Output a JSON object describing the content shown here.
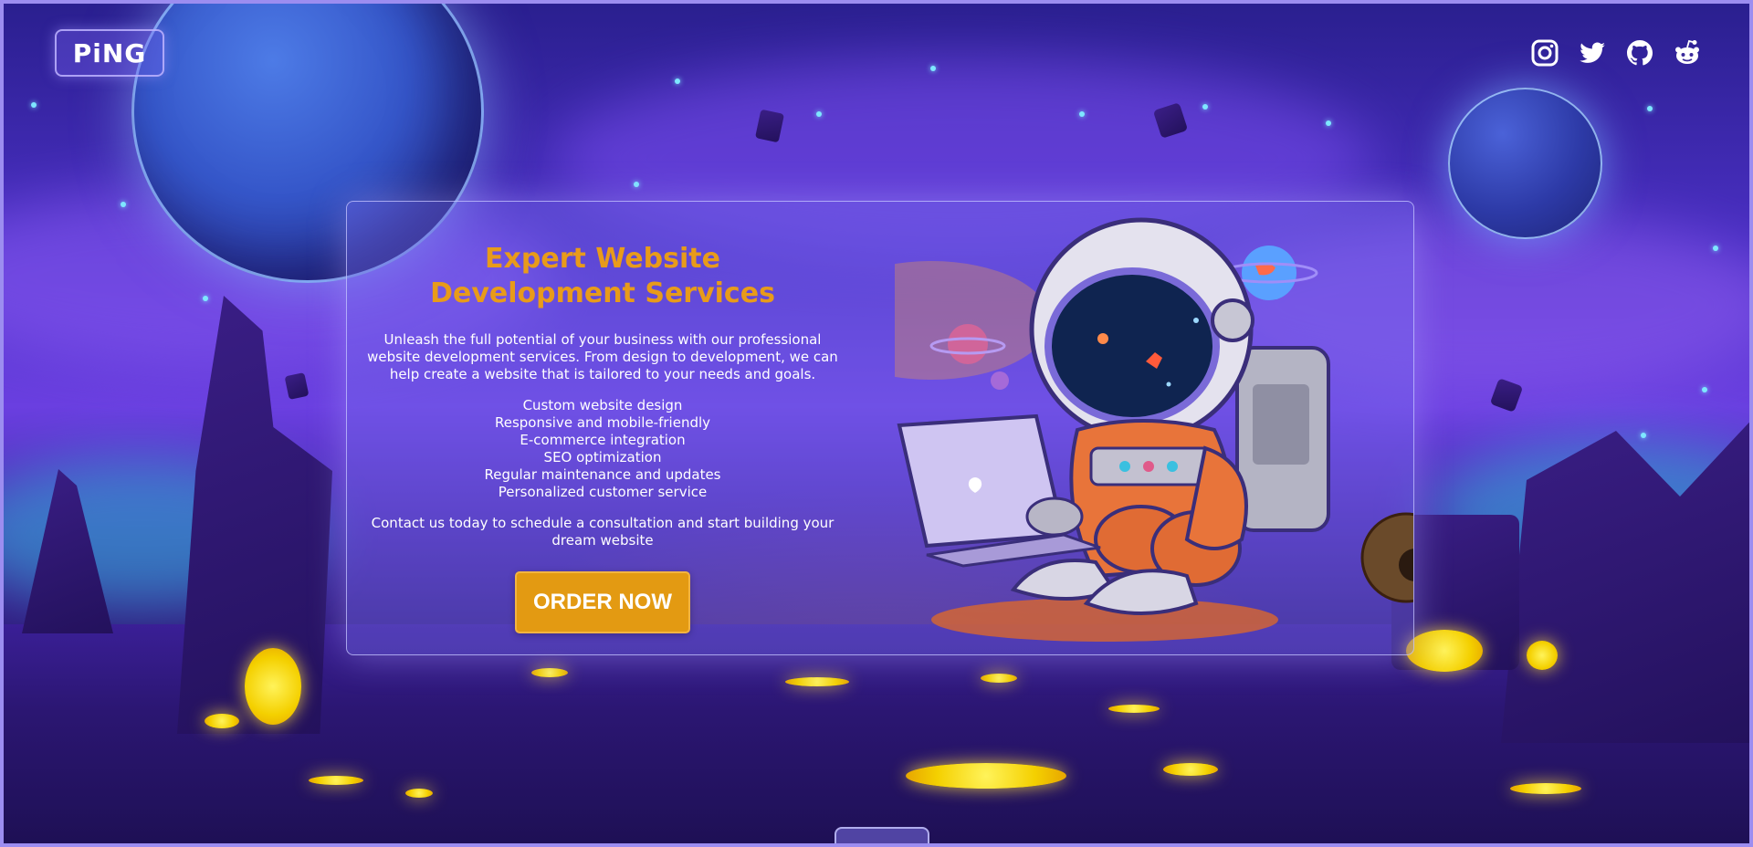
{
  "logo": {
    "text": "PiNG"
  },
  "socials": [
    {
      "name": "instagram",
      "icon": "instagram-icon"
    },
    {
      "name": "twitter",
      "icon": "twitter-icon"
    },
    {
      "name": "github",
      "icon": "github-icon"
    },
    {
      "name": "reddit",
      "icon": "reddit-icon"
    }
  ],
  "hero": {
    "title": "Expert Website Development Services",
    "intro": "Unleash the full potential of your business with our professional website development services. From design to development, we can help create a website that is tailored to your needs and goals.",
    "features": [
      "Custom website design",
      "Responsive and mobile-friendly",
      "E-commerce integration",
      "SEO optimization",
      "Regular maintenance and updates",
      "Personalized customer service"
    ],
    "contact": "Contact us today to schedule a consultation and start building your dream website",
    "cta_label": "ORDER NOW"
  },
  "colors": {
    "accent": "#e39a12",
    "title": "#e89b1a",
    "background": "#4a2fc2",
    "card_border": "#c8c8ff"
  }
}
